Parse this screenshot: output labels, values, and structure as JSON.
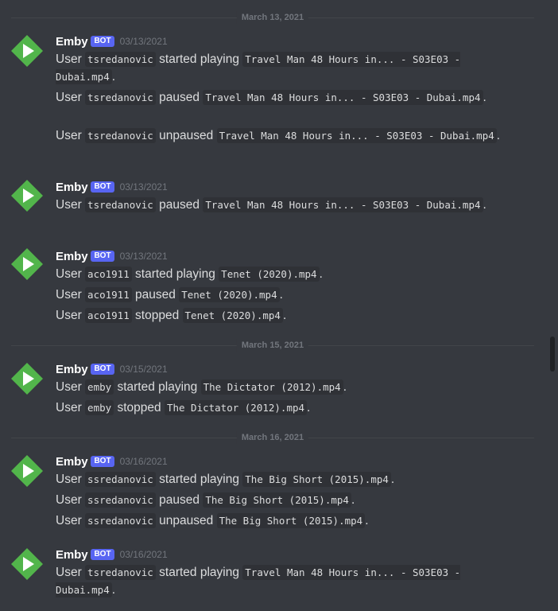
{
  "dividers": [
    "March 13, 2021",
    "March 15, 2021",
    "March 16, 2021"
  ],
  "bot": {
    "name": "Emby",
    "tag": "BOT",
    "avatar_color": "#52b54b"
  },
  "groups": [
    {
      "timestamp": "03/13/2021",
      "lines": [
        {
          "prefix": "User ",
          "user": "tsredanovic",
          "action": " started playing ",
          "file": "Travel Man 48 Hours in... - S03E03 - Dubai.mp4",
          "suffix": "."
        },
        {
          "prefix": "User ",
          "user": "tsredanovic",
          "action": " paused ",
          "file": "Travel Man 48 Hours in... - S03E03 - Dubai.mp4",
          "suffix": "."
        },
        {
          "prefix": "User ",
          "user": "tsredanovic",
          "action": " unpaused ",
          "file": "Travel Man 48 Hours in... - S03E03 - Dubai.mp4",
          "suffix": "."
        }
      ]
    },
    {
      "timestamp": "03/13/2021",
      "lines": [
        {
          "prefix": "User ",
          "user": "tsredanovic",
          "action": " paused ",
          "file": "Travel Man 48 Hours in... - S03E03 - Dubai.mp4",
          "suffix": "."
        }
      ]
    },
    {
      "timestamp": "03/13/2021",
      "lines": [
        {
          "prefix": "User ",
          "user": "aco1911",
          "action": " started playing ",
          "file": "Tenet (2020).mp4",
          "suffix": "."
        },
        {
          "prefix": "User ",
          "user": "aco1911",
          "action": " paused ",
          "file": "Tenet (2020).mp4",
          "suffix": "."
        },
        {
          "prefix": "User ",
          "user": "aco1911",
          "action": " stopped ",
          "file": "Tenet (2020).mp4",
          "suffix": "."
        }
      ]
    },
    {
      "timestamp": "03/15/2021",
      "lines": [
        {
          "prefix": "User ",
          "user": "emby",
          "action": " started playing ",
          "file": "The Dictator (2012).mp4",
          "suffix": "."
        },
        {
          "prefix": "User ",
          "user": "emby",
          "action": " stopped ",
          "file": "The Dictator (2012).mp4",
          "suffix": "."
        }
      ]
    },
    {
      "timestamp": "03/16/2021",
      "lines": [
        {
          "prefix": "User ",
          "user": "ssredanovic",
          "action": " started playing ",
          "file": "The Big Short (2015).mp4",
          "suffix": "."
        },
        {
          "prefix": "User ",
          "user": "ssredanovic",
          "action": " paused ",
          "file": "The Big Short (2015).mp4",
          "suffix": "."
        },
        {
          "prefix": "User ",
          "user": "ssredanovic",
          "action": " unpaused ",
          "file": "The Big Short (2015).mp4",
          "suffix": "."
        }
      ]
    },
    {
      "timestamp": "03/16/2021",
      "lines": [
        {
          "prefix": "User ",
          "user": "tsredanovic",
          "action": " started playing ",
          "file": "Travel Man 48 Hours in... - S03E03 - Dubai.mp4",
          "suffix": "."
        }
      ]
    }
  ]
}
